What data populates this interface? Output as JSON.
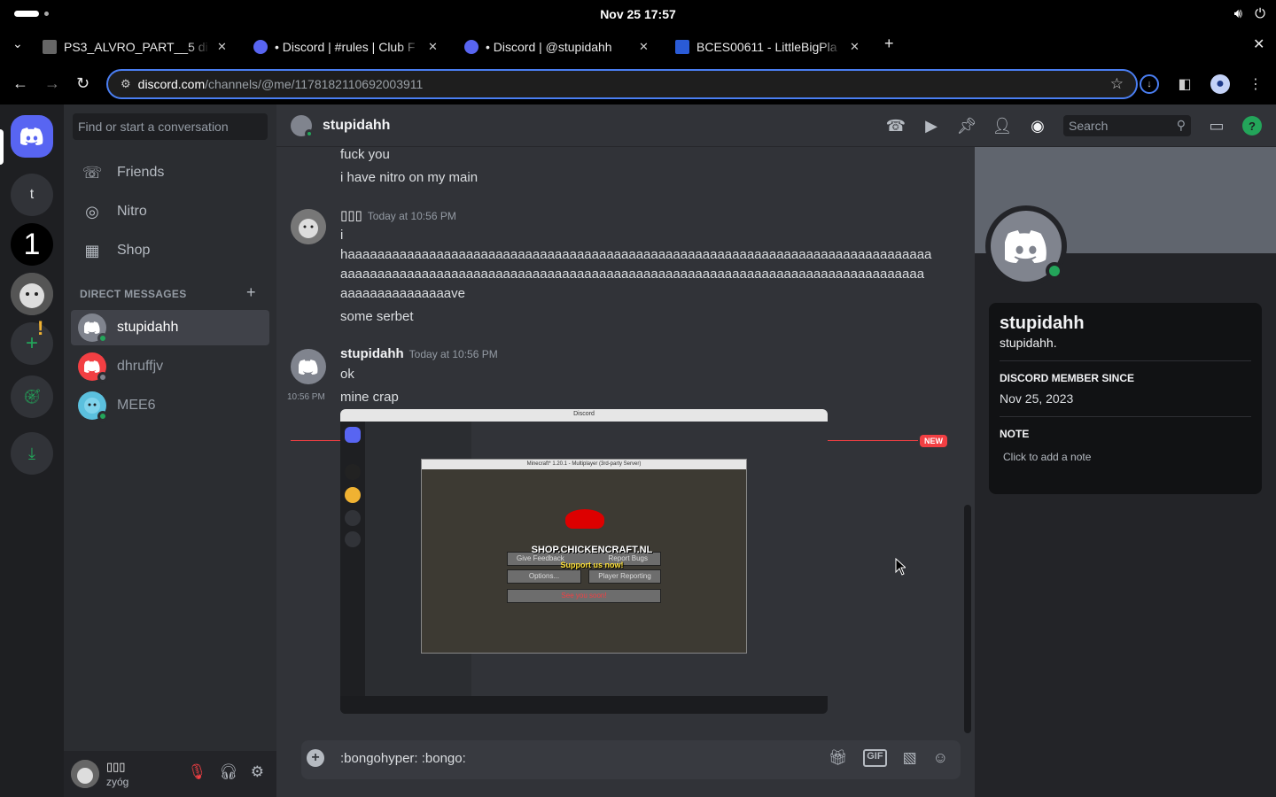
{
  "os": {
    "clock": "Nov 25  17:57"
  },
  "tabs": [
    {
      "title": "PS3_ALVRO_PART__5 di",
      "color": "#444"
    },
    {
      "title": "• Discord | #rules | Club F",
      "color": "#5865f2"
    },
    {
      "title": "• Discord | @stupidahh",
      "color": "#5865f2"
    },
    {
      "title": "BCES00611 - LittleBigPla",
      "color": "#2a5bd7"
    }
  ],
  "address": {
    "host": "discord.com",
    "path": "/channels/@me/1178182110692003911"
  },
  "guilds": {
    "t_label": "t",
    "one_label": "1"
  },
  "dm_sidebar": {
    "search_placeholder": "Find or start a conversation",
    "nav": [
      {
        "label": "Friends"
      },
      {
        "label": "Nitro"
      },
      {
        "label": "Shop"
      }
    ],
    "section_header": "DIRECT MESSAGES",
    "dms": [
      {
        "name": "stupidahh",
        "color": "#80848e",
        "status": "#23a55a"
      },
      {
        "name": "dhruffjv",
        "color": "#f23f43",
        "status": "#80848e"
      },
      {
        "name": "MEE6",
        "color": "#5bc0de",
        "status": "#23a55a"
      }
    ]
  },
  "user": {
    "name": "▯▯▯",
    "status": "zyóg"
  },
  "chat": {
    "title": "stupidahh",
    "search_placeholder": "Search",
    "messages": [
      {
        "text": "fuck you"
      },
      {
        "text": "i have nitro on my main"
      },
      {
        "author": "▯▯▯",
        "time": "Today at 10:56 PM",
        "lines": [
          "i",
          "haaaaaaaaaaaaaaaaaaaaaaaaaaaaaaaaaaaaaaaaaaaaaaaaaaaaaaaaaaaaaaaaaaaaaaaaaaaaaaa",
          "aaaaaaaaaaaaaaaaaaaaaaaaaaaaaaaaaaaaaaaaaaaaaaaaaaaaaaaaaaaaaaaaaaaaaaaaaaaaaaa",
          "aaaaaaaaaaaaaaave",
          "some serbet"
        ]
      },
      {
        "author": "stupidahh",
        "time": "Today at 10:56 PM",
        "lines": [
          "ok",
          "mine crap"
        ],
        "side_time": "10:56 PM"
      }
    ],
    "new_badge": "NEW",
    "attachment": {
      "inner_title": "Discord",
      "mc_title": "Minecraft* 1.20.1 - Multiplayer (3rd-party Server)",
      "banner": "SHOP.CHICKENCRAFT.NL",
      "banner_sub": "Support us now!",
      "buttons": [
        "Give Feedback",
        "Report Bugs",
        "Options...",
        "Player Reporting",
        "See you soon!"
      ]
    },
    "composer_text": ":bongohyper: :bongo:"
  },
  "profile": {
    "display_name": "stupidahh",
    "username": "stupidahh.",
    "member_since_label": "DISCORD MEMBER SINCE",
    "member_since": "Nov 25, 2023",
    "note_label": "NOTE",
    "note_placeholder": "Click to add a note"
  }
}
